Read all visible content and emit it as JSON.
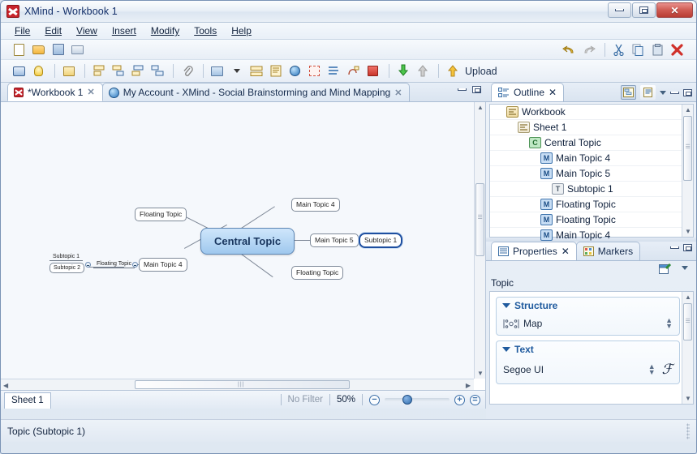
{
  "window": {
    "title": "XMind - Workbook 1",
    "app_icon": "xmind-logo-icon",
    "minimize": "minimize-icon",
    "maximize": "maximize-icon",
    "close": "✕"
  },
  "menubar": [
    {
      "label": "File"
    },
    {
      "label": "Edit"
    },
    {
      "label": "View"
    },
    {
      "label": "Insert"
    },
    {
      "label": "Modify"
    },
    {
      "label": "Tools"
    },
    {
      "label": "Help"
    }
  ],
  "toolbar": {
    "row1": [
      {
        "name": "new-icon"
      },
      {
        "name": "open-icon"
      },
      {
        "name": "save-icon"
      },
      {
        "name": "print-icon"
      }
    ],
    "row1_right": [
      {
        "name": "undo-icon"
      },
      {
        "name": "redo-icon"
      },
      {
        "name": "cut-icon"
      },
      {
        "name": "copy-icon"
      },
      {
        "name": "paste-icon"
      },
      {
        "name": "delete-icon"
      }
    ],
    "row2": [
      {
        "name": "presentation-icon"
      },
      {
        "name": "brainstorm-icon"
      },
      {
        "name": "new-map-icon"
      },
      {
        "name": "insert-topic-icon"
      },
      {
        "name": "insert-subtopic-icon"
      },
      {
        "name": "insert-parent-topic-icon"
      },
      {
        "name": "insert-floating-topic-icon"
      },
      {
        "name": "attachment-icon"
      },
      {
        "name": "insert-image-icon"
      },
      {
        "name": "image-dropdown-caret-icon"
      },
      {
        "name": "boundary-icon"
      },
      {
        "name": "notes-icon"
      },
      {
        "name": "hyperlink-icon"
      },
      {
        "name": "summary-icon"
      },
      {
        "name": "label-icon"
      },
      {
        "name": "relationship-icon"
      },
      {
        "name": "marker-icon"
      }
    ],
    "row2_right": [
      {
        "name": "download-icon"
      },
      {
        "name": "upload-gray-icon"
      }
    ],
    "upload_label": "Upload"
  },
  "editor_tabs": [
    {
      "label": "*Workbook 1",
      "icon": "xmind-file-icon",
      "active": true,
      "close": "✕"
    },
    {
      "label": "My Account - XMind - Social Brainstorming and Mind Mapping",
      "icon": "globe-icon",
      "active": false,
      "close": "✕"
    }
  ],
  "editor_tab_controls": {
    "minimize": "minimize-icon",
    "maximize": "maximize-icon"
  },
  "mindmap": {
    "central": {
      "label": "Central Topic"
    },
    "nodes": [
      {
        "id": "floating-topic-top-left",
        "label": "Floating Topic"
      },
      {
        "id": "main-topic-4-top",
        "label": "Main Topic 4"
      },
      {
        "id": "main-topic-5",
        "label": "Main Topic 5"
      },
      {
        "id": "subtopic-1-selected",
        "label": "Subtopic 1",
        "selected": true
      },
      {
        "id": "floating-topic-bottom",
        "label": "Floating Topic"
      },
      {
        "id": "main-topic-4-left",
        "label": "Main Topic 4"
      },
      {
        "id": "floating-topic-left",
        "label": "Floating Topic"
      },
      {
        "id": "subtopic-1-left",
        "label": "Subtopic 1"
      },
      {
        "id": "subtopic-2-left",
        "label": "Subtopic 2"
      }
    ]
  },
  "sheetbar": {
    "sheet_label": "Sheet 1",
    "filter": "No Filter",
    "zoom": "50%",
    "zoom_out": "−",
    "zoom_in": "+",
    "zoom_fit": "="
  },
  "statusbar": {
    "text": "Topic (Subtopic 1)"
  },
  "outline": {
    "tab_label": "Outline",
    "tab_icon": "outline-icon",
    "tab_close": "✕",
    "tools": [
      {
        "name": "outline-view-button",
        "pressed": true
      },
      {
        "name": "sheet-view-button",
        "pressed": false
      },
      {
        "name": "view-menu-caret-icon",
        "pressed": false
      },
      {
        "name": "minimize-icon",
        "pressed": false
      },
      {
        "name": "maximize-icon",
        "pressed": false
      }
    ],
    "rows": [
      {
        "label": "Workbook",
        "icon": "workbook-icon",
        "icon_letter": "",
        "indent": 1,
        "type": "wb"
      },
      {
        "label": "Sheet 1",
        "icon": "sheet-icon",
        "icon_letter": "",
        "indent": 2,
        "type": "sheet"
      },
      {
        "label": "Central Topic",
        "icon": "central-topic-icon",
        "icon_letter": "C",
        "indent": 3,
        "type": "c"
      },
      {
        "label": "Main Topic 4",
        "icon": "main-topic-icon",
        "icon_letter": "M",
        "indent": 4,
        "type": "m"
      },
      {
        "label": "Main Topic 5",
        "icon": "main-topic-icon",
        "icon_letter": "M",
        "indent": 4,
        "type": "m"
      },
      {
        "label": "Subtopic 1",
        "icon": "subtopic-icon",
        "icon_letter": "T",
        "indent": 5,
        "type": "t"
      },
      {
        "label": "Floating Topic",
        "icon": "main-topic-icon",
        "icon_letter": "M",
        "indent": 4,
        "type": "m"
      },
      {
        "label": "Floating Topic",
        "icon": "main-topic-icon",
        "icon_letter": "M",
        "indent": 4,
        "type": "m"
      },
      {
        "label": "Main Topic 4",
        "icon": "main-topic-icon",
        "icon_letter": "M",
        "indent": 4,
        "type": "m"
      }
    ]
  },
  "properties": {
    "tabs": [
      {
        "label": "Properties",
        "icon": "properties-icon",
        "active": true,
        "close": "✕"
      },
      {
        "label": "Markers",
        "icon": "markers-icon",
        "active": false
      }
    ],
    "controls": {
      "minimize": "minimize-icon",
      "maximize": "maximize-icon",
      "pin": "pin-properties-icon",
      "menu_caret": "view-menu-caret-icon"
    },
    "context_label": "Topic",
    "groups": [
      {
        "title": "Structure",
        "value": "Map",
        "value_icon": "structure-map-icon"
      },
      {
        "title": "Text",
        "value": "Segoe UI",
        "value_icon": "font-icon"
      }
    ]
  }
}
